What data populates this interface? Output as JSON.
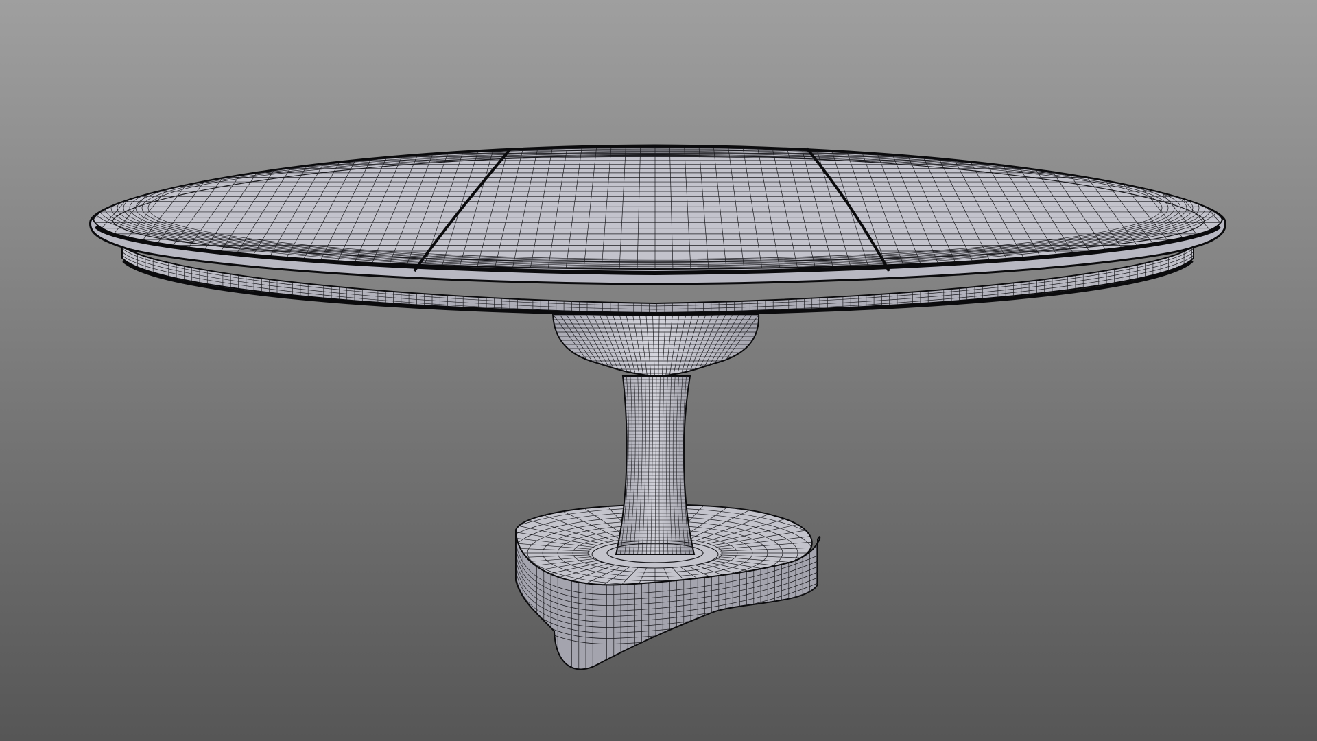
{
  "viewport": {
    "background_top": "#9f9f9f",
    "background_bottom": "#565656"
  },
  "model": {
    "object": "pedestal-table",
    "render_style": "wireframe-on-shaded",
    "surface_color": "#c6c6ce",
    "surface_shadow": "#8d8d97",
    "wire_color": "#1b1b1f",
    "edge_color": "#0b0b0d",
    "top_leaves": 3,
    "wire_grid_density": "high"
  }
}
